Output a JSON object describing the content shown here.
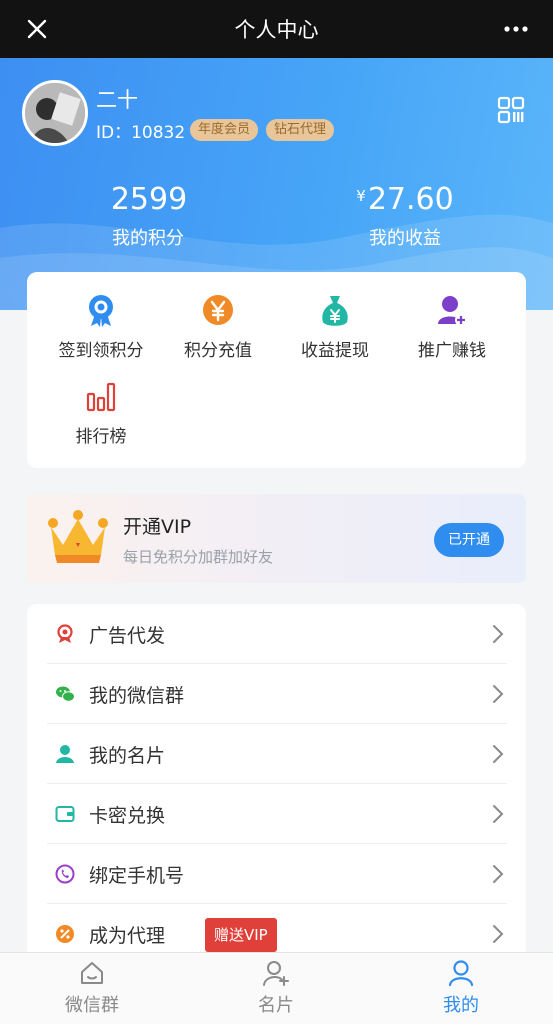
{
  "topbar": {
    "title": "个人中心",
    "close_icon": "close-icon",
    "more_icon": "more-icon"
  },
  "profile": {
    "name": "二十",
    "id_text": "ID：10832",
    "badges": [
      "年度会员",
      "钻石代理"
    ],
    "qr_icon": "qr-code-icon"
  },
  "stats": [
    {
      "currency": "",
      "value": "2599",
      "label": "我的积分"
    },
    {
      "currency": "¥",
      "value": "27.60",
      "label": "我的收益"
    }
  ],
  "quick_actions": [
    {
      "label": "签到领积分",
      "icon": "award-icon",
      "color": "#2f8df0"
    },
    {
      "label": "积分充值",
      "icon": "yen-circle-icon",
      "color": "#f08a26"
    },
    {
      "label": "收益提现",
      "icon": "money-bag-icon",
      "color": "#22b6a4"
    },
    {
      "label": "推广赚钱",
      "icon": "user-add-icon",
      "color": "#7b3fc9"
    },
    {
      "label": "排行榜",
      "icon": "bar-chart-icon",
      "color": "#e0403a"
    }
  ],
  "vip": {
    "title": "开通VIP",
    "subtitle": "每日免积分加群加好友",
    "button": "已开通",
    "icon": "crown-icon"
  },
  "menu": [
    {
      "label": "广告代发",
      "icon": "ribbon-icon",
      "color": "#e0403a"
    },
    {
      "label": "我的微信群",
      "icon": "wechat-icon",
      "color": "#31b24a"
    },
    {
      "label": "我的名片",
      "icon": "person-icon",
      "color": "#22b6a4"
    },
    {
      "label": "卡密兑换",
      "icon": "wallet-icon",
      "color": "#22b6a4"
    },
    {
      "label": "绑定手机号",
      "icon": "phone-icon",
      "color": "#9b3fc9"
    },
    {
      "label": "成为代理",
      "icon": "agent-icon",
      "color": "#f08a26",
      "tag": "赠送VIP"
    }
  ],
  "tabbar": [
    {
      "label": "微信群",
      "icon": "home-icon",
      "active": false
    },
    {
      "label": "名片",
      "icon": "add-user-icon",
      "active": false
    },
    {
      "label": "我的",
      "icon": "user-icon",
      "active": true
    }
  ],
  "colors": {
    "accent": "#2f8df0",
    "hero_start": "#3d8ff2",
    "hero_end": "#5bb5fa",
    "tag_red": "#e0403a",
    "badge_gold": "#e9c69a"
  }
}
